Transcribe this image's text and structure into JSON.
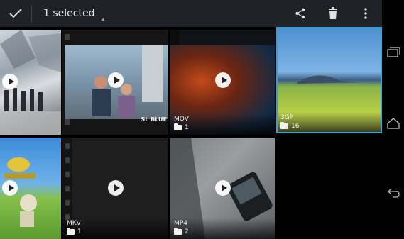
{
  "action_bar": {
    "title": "1 selected"
  },
  "albums": [
    {
      "id": "album-top-left",
      "format": "",
      "count": ""
    },
    {
      "id": "album-top-2",
      "format": "",
      "count": "",
      "watermark": "SL BLUE"
    },
    {
      "id": "album-top-3",
      "format": "MOV",
      "count": "1"
    },
    {
      "id": "album-top-4",
      "format": "3GP",
      "count": "16"
    },
    {
      "id": "album-bottom-1",
      "format": "",
      "count": ""
    },
    {
      "id": "album-bottom-2",
      "format": "MKV",
      "count": "1"
    },
    {
      "id": "album-bottom-3",
      "format": "MP4",
      "count": "2"
    }
  ],
  "colors": {
    "accent": "#2aa6d6",
    "action_bar": "#1f2327"
  }
}
